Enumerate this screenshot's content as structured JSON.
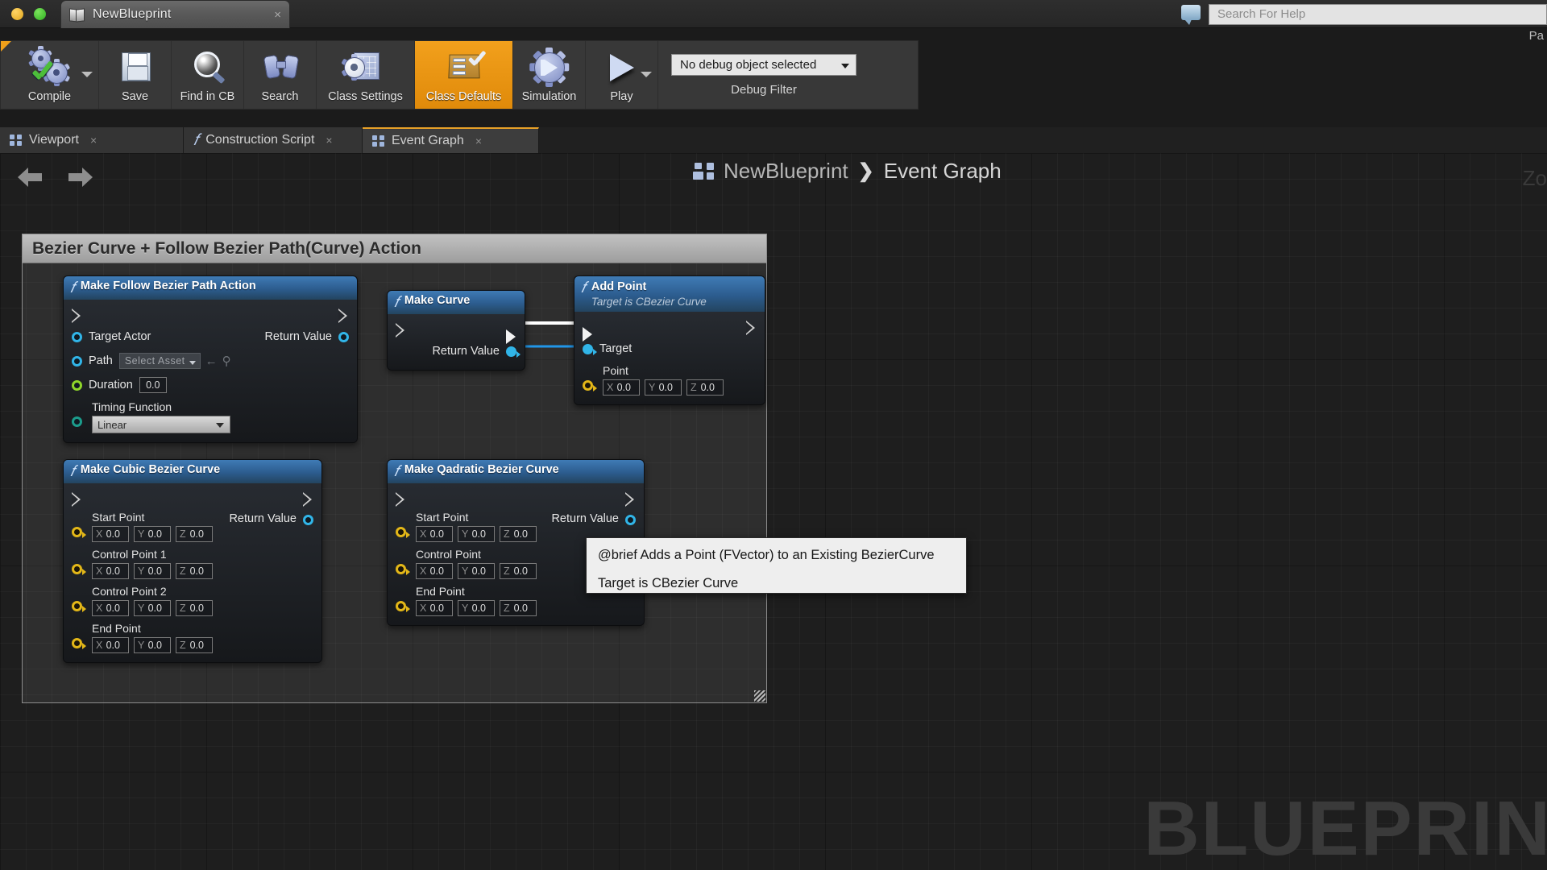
{
  "titlebar": {
    "tab_title": "NewBlueprint",
    "tab_close": "×",
    "help_placeholder": "Search For Help",
    "pa_label": "Pa"
  },
  "toolbar": {
    "items": [
      {
        "label": "Compile",
        "icon": "compile-gears-check-icon",
        "active": false,
        "has_dropdown": true
      },
      {
        "label": "Save",
        "icon": "floppy-disk-icon",
        "active": false,
        "has_dropdown": false
      },
      {
        "label": "Find in CB",
        "icon": "magnifier-icon",
        "active": false,
        "has_dropdown": false
      },
      {
        "label": "Search",
        "icon": "binoculars-icon",
        "active": false,
        "has_dropdown": false
      },
      {
        "label": "Class Settings",
        "icon": "gear-sheet-icon",
        "active": false,
        "has_dropdown": false
      },
      {
        "label": "Class Defaults",
        "icon": "clipboard-check-icon",
        "active": true,
        "has_dropdown": false
      },
      {
        "label": "Simulation",
        "icon": "gear-play-icon",
        "active": false,
        "has_dropdown": false
      },
      {
        "label": "Play",
        "icon": "play-triangle-icon",
        "active": false,
        "has_dropdown": true
      }
    ],
    "debug_object_value": "No debug object selected",
    "debug_filter_label": "Debug Filter"
  },
  "graph_tabs": [
    {
      "label": "Viewport",
      "icon": "viewport-grid-icon",
      "selected": false,
      "close": "×"
    },
    {
      "label": "Construction Script",
      "icon": "function-fx-icon",
      "selected": false,
      "close": "×"
    },
    {
      "label": "Event Graph",
      "icon": "event-graph-icon",
      "selected": true,
      "close": "×"
    }
  ],
  "breadcrumb": {
    "icon": "blueprint-nodes-icon",
    "root": "NewBlueprint",
    "separator": "❯",
    "current": "Event Graph"
  },
  "canvas": {
    "zoom_label": "Zo",
    "watermark": "BLUEPRIN"
  },
  "comment": {
    "title": "Bezier Curve + Follow Bezier Path(Curve) Action"
  },
  "nodes": [
    {
      "id": "make-follow-bezier-path-action",
      "title": "Make Follow Bezier Path Action",
      "subtitle": "",
      "inputs": [
        {
          "label": "Target Actor",
          "pin": "object"
        },
        {
          "label": "Path",
          "pin": "object",
          "widget": "asset",
          "widget_value": "Select Asset"
        },
        {
          "label": "Duration",
          "pin": "float",
          "widget": "number",
          "widget_value": "0.0"
        },
        {
          "label": "Timing Function",
          "pin": "enum",
          "widget": "combo",
          "widget_value": "Linear"
        }
      ],
      "outputs": [
        {
          "label": "Return Value",
          "pin": "object"
        }
      ]
    },
    {
      "id": "make-curve",
      "title": "Make Curve",
      "subtitle": "",
      "inputs": [],
      "outputs": [
        {
          "label": "Return Value",
          "pin": "object-filled"
        }
      ]
    },
    {
      "id": "add-point",
      "title": "Add Point",
      "subtitle": "Target is CBezier Curve",
      "inputs": [
        {
          "label": "Target",
          "pin": "object-filled"
        },
        {
          "label": "Point",
          "pin": "struct",
          "widget": "vector",
          "widget_value": [
            "0.0",
            "0.0",
            "0.0"
          ]
        }
      ],
      "outputs": []
    },
    {
      "id": "make-cubic-bezier-curve",
      "title": "Make Cubic Bezier Curve",
      "subtitle": "",
      "inputs": [
        {
          "label": "Start Point",
          "pin": "struct",
          "widget": "vector",
          "widget_value": [
            "0.0",
            "0.0",
            "0.0"
          ]
        },
        {
          "label": "Control Point 1",
          "pin": "struct",
          "widget": "vector",
          "widget_value": [
            "0.0",
            "0.0",
            "0.0"
          ]
        },
        {
          "label": "Control Point 2",
          "pin": "struct",
          "widget": "vector",
          "widget_value": [
            "0.0",
            "0.0",
            "0.0"
          ]
        },
        {
          "label": "End Point",
          "pin": "struct",
          "widget": "vector",
          "widget_value": [
            "0.0",
            "0.0",
            "0.0"
          ]
        }
      ],
      "outputs": [
        {
          "label": "Return Value",
          "pin": "object"
        }
      ]
    },
    {
      "id": "make-qadratic-bezier-curve",
      "title": "Make Qadratic Bezier Curve",
      "subtitle": "",
      "inputs": [
        {
          "label": "Start Point",
          "pin": "struct",
          "widget": "vector",
          "widget_value": [
            "0.0",
            "0.0",
            "0.0"
          ]
        },
        {
          "label": "Control Point",
          "pin": "struct",
          "widget": "vector",
          "widget_value": [
            "0.0",
            "0.0",
            "0.0"
          ]
        },
        {
          "label": "End Point",
          "pin": "struct",
          "widget": "vector",
          "widget_value": [
            "0.0",
            "0.0",
            "0.0"
          ]
        }
      ],
      "outputs": [
        {
          "label": "Return Value",
          "pin": "object"
        }
      ]
    }
  ],
  "vector_axes": {
    "x": "X",
    "y": "Y",
    "z": "Z"
  },
  "tooltip": {
    "line1": "@brief Adds a Point (FVector) to an Existing BezierCurve",
    "line2": "Target is CBezier Curve"
  },
  "colors": {
    "accent_orange": "#f0a01a",
    "node_header_blue": "#2c5c8e",
    "pin_object_cyan": "#31b5e8",
    "pin_float_green": "#8fd62a",
    "pin_struct_yellow": "#e3b718",
    "pin_enum_teal": "#1c9c8c",
    "canvas_bg": "#1e1e1e"
  }
}
